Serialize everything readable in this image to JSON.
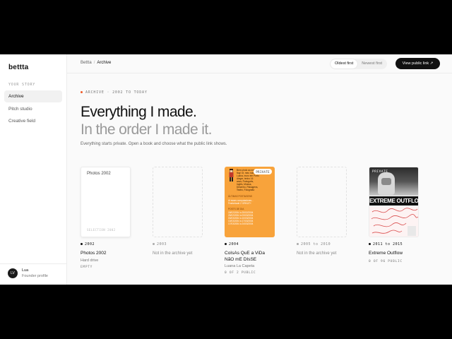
{
  "app": {
    "logo": "bettta"
  },
  "sidebar": {
    "section_label": "YOUR STORY",
    "items": [
      {
        "label": "Archive",
        "active": true
      },
      {
        "label": "Pitch studio",
        "active": false
      },
      {
        "label": "Creative field",
        "active": false
      }
    ],
    "user": {
      "initials": "LV",
      "name": "Lua",
      "role": "Founder profile"
    }
  },
  "topbar": {
    "breadcrumb": [
      "Bettta",
      "Archive"
    ],
    "sort": {
      "options": [
        "Oldest first",
        "Newest first"
      ],
      "selected": "Oldest first"
    },
    "public_link_label": "View public link ↗"
  },
  "hero": {
    "eyebrow": "ARCHIVE · 2002 TO TODAY",
    "title_line1": "Everything I made.",
    "title_line2": "In the order I made it.",
    "lede": "Everything starts private. Open a book and choose what the public link shows."
  },
  "books": [
    {
      "year": "2002",
      "cover_title": "Photos 2002",
      "cover_footer": "SELECTION 2002",
      "title": "Photos 2002",
      "subtitle": "Hard drive",
      "meta": "EMPTY",
      "kind": "paper"
    },
    {
      "year": "2003",
      "title": "Not in the archive yet",
      "kind": "empty"
    },
    {
      "year": "2004",
      "badge": "PRIVATE",
      "title": "CoIsAs QuE a ViDa NãO mE DIsSE",
      "subtitle": "Luana La Capeta",
      "meta": "0 OF 2 PUBLIC",
      "kind": "orange",
      "cover_text": "Bem-vindo ao meu flog! Oi, meu nome é Luana, moro em Porto Alegre, tenho 16 anos, Português, Inglês, Música, Desenho, Paisagens, Teatro, Fotografia",
      "cover_heading": "ÚLTIMAS POSTAGENS",
      "cover_lines": [
        "Ai esses computadores...",
        "Festividade 2 ORKUT+",
        "",
        "POSTS DE DIA",
        "18/02/2004 à 25/02/2004",
        "25/02/2004 à 03/03/2004",
        "03/03/2004 à 10/03/2004",
        "10/03/2004 à 17/03/2004",
        "17/03/2004 à 24/03/2004"
      ]
    },
    {
      "year": "2005 to 2010",
      "title": "Not in the archive yet",
      "kind": "empty"
    },
    {
      "year": "2011 to 2015",
      "badge": "PRIVATE",
      "cover_band": "EXTREME OUTFLOW",
      "title": "Extreme Outflow",
      "meta": "0 OF 96 PUBLIC",
      "kind": "photo"
    }
  ],
  "colors": {
    "accent_dot": "#f05a28",
    "orange_cover": "#f8a33b",
    "button_dark": "#111111"
  }
}
